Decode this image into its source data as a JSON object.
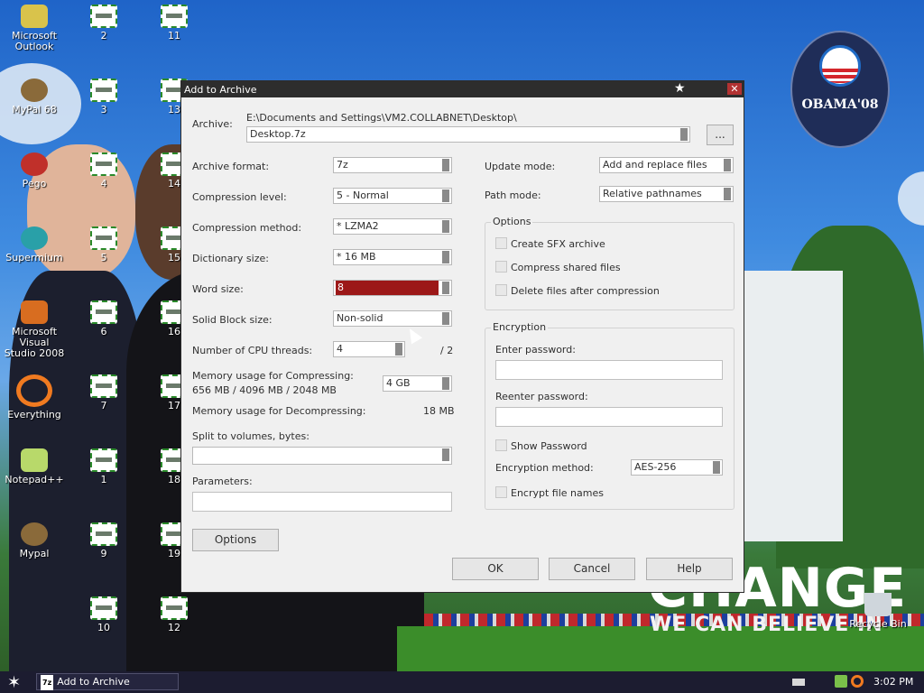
{
  "desktop": {
    "icons": [
      {
        "label": "Microsoft\nOutlook",
        "kind": "outlook"
      },
      {
        "label": "2",
        "kind": "num"
      },
      {
        "label": "11",
        "kind": "num"
      },
      {
        "label": "MyPal 68",
        "kind": "mypal"
      },
      {
        "label": "3",
        "kind": "num"
      },
      {
        "label": "13",
        "kind": "num"
      },
      {
        "label": "Pego",
        "kind": "pego"
      },
      {
        "label": "4",
        "kind": "num"
      },
      {
        "label": "14",
        "kind": "num"
      },
      {
        "label": "Supermium",
        "kind": "supermium"
      },
      {
        "label": "5",
        "kind": "num"
      },
      {
        "label": "15",
        "kind": "num"
      },
      {
        "label": "Microsoft Visual\nStudio 2008",
        "kind": "vs"
      },
      {
        "label": "6",
        "kind": "num"
      },
      {
        "label": "16",
        "kind": "num"
      },
      {
        "label": "Everything",
        "kind": "everything"
      },
      {
        "label": "7",
        "kind": "num"
      },
      {
        "label": "17",
        "kind": "num"
      },
      {
        "label": "Notepad++",
        "kind": "npp"
      },
      {
        "label": "1",
        "kind": "num"
      },
      {
        "label": "18",
        "kind": "num"
      },
      {
        "label": "Mypal",
        "kind": "mypal"
      },
      {
        "label": "9",
        "kind": "num"
      },
      {
        "label": "19",
        "kind": "num"
      },
      {
        "label": "10",
        "kind": "num"
      },
      {
        "label": "12",
        "kind": "num"
      },
      {
        "label": "Recycle Bin",
        "kind": "bin"
      }
    ],
    "wallpaper": {
      "logo_text": "OBAMA'08",
      "headline": "CHANGE",
      "subline": "WE CAN BELIEVE IN"
    }
  },
  "dialog": {
    "title": "Add to Archive",
    "archive_label": "Archive:",
    "archive_path": "E:\\Documents and Settings\\VM2.COLLABNET\\Desktop\\",
    "archive_name": "Desktop.7z",
    "browse_label": "...",
    "archive_format_label": "Archive format:",
    "archive_format_value": "7z",
    "compression_level_label": "Compression level:",
    "compression_level_value": "5 - Normal",
    "compression_method_label": "Compression method:",
    "compression_method_value": "*  LZMA2",
    "dictionary_size_label": "Dictionary size:",
    "dictionary_size_value": "*  16 MB",
    "word_size_label": "Word size:",
    "word_size_value": "8",
    "solid_block_label": "Solid Block size:",
    "solid_block_value": "Non-solid",
    "cpu_threads_label": "Number of CPU threads:",
    "cpu_threads_value": "4",
    "cpu_threads_max": "/ 2",
    "mem_compress_label": "Memory usage for Compressing:",
    "mem_compress_detail": "656 MB / 4096 MB / 2048 MB",
    "mem_compress_value": "4 GB",
    "mem_decompress_label": "Memory usage for Decompressing:",
    "mem_decompress_value": "18 MB",
    "split_label": "Split to volumes, bytes:",
    "split_value": "",
    "parameters_label": "Parameters:",
    "parameters_value": "",
    "options_button": "Options",
    "update_mode_label": "Update mode:",
    "update_mode_value": "Add and replace files",
    "path_mode_label": "Path mode:",
    "path_mode_value": "Relative pathnames",
    "options_group": {
      "title": "Options",
      "create_sfx": "Create SFX archive",
      "compress_shared": "Compress shared files",
      "delete_after": "Delete files after compression"
    },
    "encryption_group": {
      "title": "Encryption",
      "enter_password_label": "Enter password:",
      "enter_password_value": "",
      "reenter_password_label": "Reenter password:",
      "reenter_password_value": "",
      "show_password": "Show Password",
      "method_label": "Encryption method:",
      "method_value": "AES-256",
      "encrypt_names": "Encrypt file names"
    },
    "ok_button": "OK",
    "cancel_button": "Cancel",
    "help_button": "Help"
  },
  "taskbar": {
    "task_label": "Add to Archive",
    "task_icon_text": "7z",
    "clock": "3:02 PM"
  }
}
